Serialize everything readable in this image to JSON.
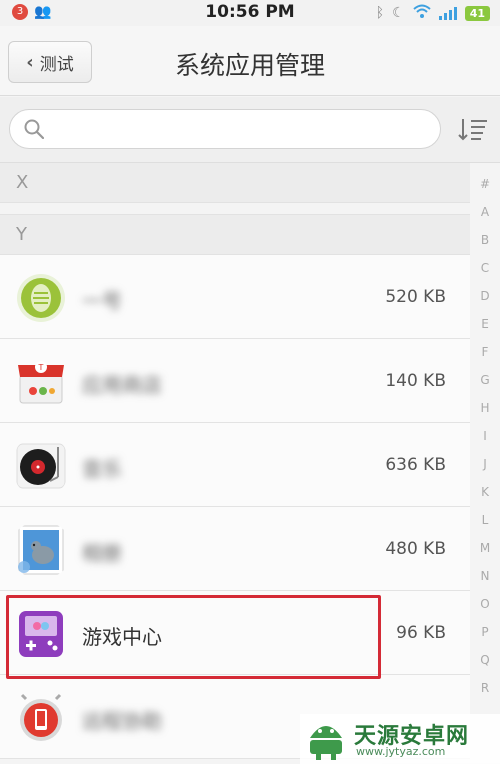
{
  "status_bar": {
    "notification_count": "3",
    "time": "10:56 PM",
    "battery": "41"
  },
  "header": {
    "back_label": "测试",
    "title": "系统应用管理"
  },
  "search": {
    "placeholder": ""
  },
  "sections": [
    {
      "letter": "X"
    },
    {
      "letter": "Y"
    }
  ],
  "apps": [
    {
      "name": "一号",
      "size": "520 KB",
      "icon": "green-capsule-icon"
    },
    {
      "name": "应用商店",
      "size": "140 KB",
      "icon": "store-icon"
    },
    {
      "name": "音乐",
      "size": "636 KB",
      "icon": "record-player-icon"
    },
    {
      "name": "相册",
      "size": "480 KB",
      "icon": "bird-photo-icon"
    },
    {
      "name": "游戏中心",
      "size": "96 KB",
      "icon": "game-console-icon"
    },
    {
      "name": "远程协助",
      "size": "",
      "icon": "phone-alarm-icon"
    }
  ],
  "index_letters": [
    "#",
    "A",
    "B",
    "C",
    "D",
    "E",
    "F",
    "G",
    "H",
    "I",
    "J",
    "K",
    "L",
    "M",
    "N",
    "O",
    "P",
    "Q",
    "R"
  ],
  "watermark": {
    "name": "天源安卓网",
    "url": "www.jytyaz.com"
  },
  "colors": {
    "highlight": "#d42a36",
    "accent_blue": "#3da0e0",
    "battery_green": "#8bc83f"
  }
}
